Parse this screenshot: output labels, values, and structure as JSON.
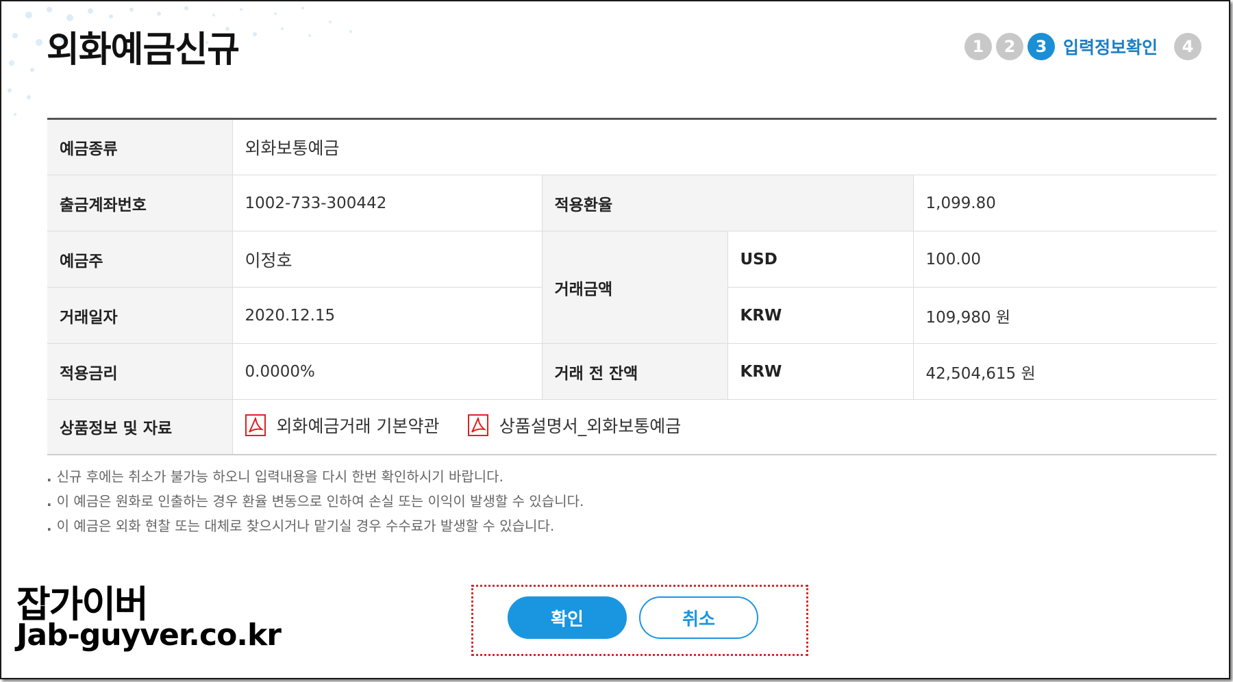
{
  "page_title": "외화예금신규",
  "steps": {
    "items": [
      "1",
      "2",
      "3",
      "4"
    ],
    "current": "3",
    "current_label": "입력정보확인"
  },
  "table": {
    "deposit_type_label": "예금종류",
    "deposit_type_value": "외화보통예금",
    "withdraw_account_label": "출금계좌번호",
    "withdraw_account_value": "1002-733-300442",
    "exchange_rate_label": "적용환율",
    "exchange_rate_value": "1,099.80",
    "holder_label": "예금주",
    "holder_value": "이정호",
    "amount_label": "거래금액",
    "usd_label": "USD",
    "usd_value": "100.00",
    "date_label": "거래일자",
    "date_value": "2020.12.15",
    "krw_label": "KRW",
    "krw_value": "109,980 원",
    "interest_label": "적용금리",
    "interest_value": "0.0000%",
    "balance_label": "거래 전 잔액",
    "balance_currency": "KRW",
    "balance_value": "42,504,615 원",
    "product_info_label": "상품정보 및 자료",
    "doc_links": [
      "외화예금거래 기본약관",
      "상품설명서_외화보통예금"
    ]
  },
  "notes": [
    "신규 후에는 취소가 불가능 하오니 입력내용을 다시 한번 확인하시기 바랍니다.",
    "이 예금은 원화로 인출하는 경우 환율 변동으로 인하여 손실 또는 이익이 발생할 수 있습니다.",
    "이 예금은 외화 현찰 또는 대체로 찾으시거나 맡기실 경우 수수료가 발생할 수 있습니다."
  ],
  "buttons": {
    "confirm": "확인",
    "cancel": "취소"
  },
  "watermark": {
    "name": "잡가이버",
    "url": "Jab-guyver.co.kr"
  },
  "colors": {
    "accent": "#1a96e0",
    "step_inactive": "#c8c8c8",
    "highlight_border": "#d42a2a"
  },
  "icons": [
    "pdf-icon"
  ]
}
